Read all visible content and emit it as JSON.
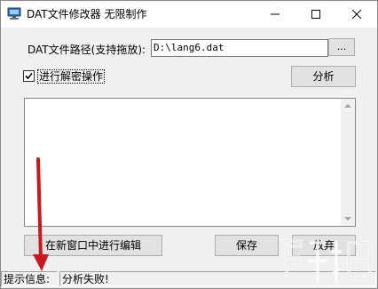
{
  "window": {
    "title": "DAT文件修改器  无限制作",
    "minimize_glyph": "—",
    "maximize_glyph": "☐",
    "close_glyph": "✕"
  },
  "form": {
    "path_label": "DAT文件路径(支持拖放):",
    "path_value": "D:\\lang6.dat",
    "browse_label": "...",
    "decrypt_label": "进行解密操作",
    "decrypt_checked": true,
    "analyze_label": "分析",
    "log_text": ""
  },
  "buttons": {
    "edit_new_window": "在新窗口中进行编辑",
    "save": "保存",
    "discard": "放弃"
  },
  "status": {
    "label": "提示信息:",
    "message": "分析失败!"
  },
  "icons": {
    "app": "computer-app-icon",
    "checkbox": "check-icon",
    "annotation": "red-arrow-icon",
    "watermark": "watermark-logo"
  },
  "colors": {
    "annotation_arrow": "#c8191e",
    "window_bg": "#f0f0f0",
    "button_bg": "#e1e1e1"
  }
}
